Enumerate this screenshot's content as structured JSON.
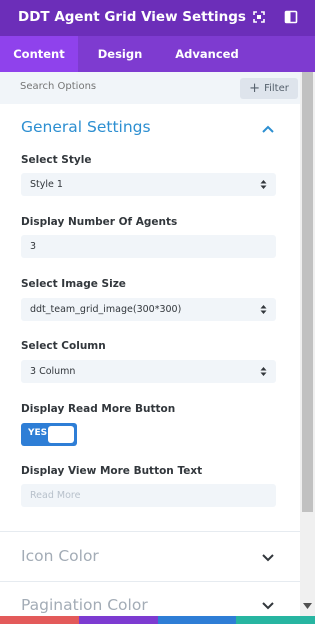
{
  "header": {
    "title": "DDT Agent Grid View Settings",
    "icons": [
      "expand-icon",
      "sidebar-toggle-icon"
    ]
  },
  "tabs": [
    {
      "label": "Content",
      "active": true
    },
    {
      "label": "Design",
      "active": false
    },
    {
      "label": "Advanced",
      "active": false
    }
  ],
  "search": {
    "placeholder": "Search Options",
    "filter_label": "Filter"
  },
  "general_settings": {
    "title": "General Settings",
    "expanded": true,
    "fields": {
      "select_style": {
        "label": "Select Style",
        "value": "Style 1"
      },
      "display_number": {
        "label": "Display Number Of Agents",
        "value": "3"
      },
      "image_size": {
        "label": "Select Image Size",
        "value": "ddt_team_grid_image(300*300)"
      },
      "select_column": {
        "label": "Select Column",
        "value": "3 Column"
      },
      "read_more_button": {
        "label": "Display Read More Button",
        "toggle_label": "YES",
        "enabled": true
      },
      "view_more_text": {
        "label": "Display View More Button Text",
        "placeholder": "Read More"
      }
    }
  },
  "collapsed_sections": [
    {
      "title": "Icon Color",
      "expanded": false
    },
    {
      "title": "Pagination Color",
      "expanded": false
    }
  ],
  "colors": {
    "header": "#6c2eb9",
    "tabs": "#7e3bd0",
    "active_tab": "#8f42ec",
    "section_title": "#2d8fd1",
    "toggle": "#2e7ed6",
    "bottom_bar": [
      "#e35a5a",
      "#7d3bd1",
      "#2e7ed6",
      "#27b5a1"
    ]
  }
}
